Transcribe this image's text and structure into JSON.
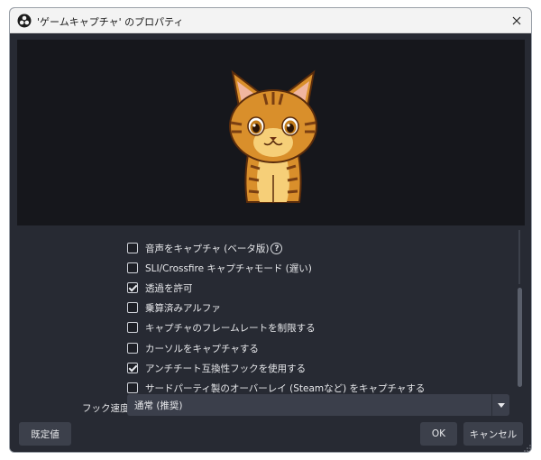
{
  "window": {
    "title": "'ゲームキャプチャ' のプロパティ",
    "close_label": "✕"
  },
  "preview": {
    "content": "cat-illustration"
  },
  "options": [
    {
      "label": "音声をキャプチャ (ベータ版)",
      "checked": false,
      "has_help": true
    },
    {
      "label": "SLI/Crossfire キャプチャモード (遅い)",
      "checked": false,
      "has_help": false
    },
    {
      "label": "透過を許可",
      "checked": true,
      "has_help": false
    },
    {
      "label": "乗算済みアルファ",
      "checked": false,
      "has_help": false
    },
    {
      "label": "キャプチャのフレームレートを制限する",
      "checked": false,
      "has_help": false
    },
    {
      "label": "カーソルをキャプチャする",
      "checked": false,
      "has_help": false
    },
    {
      "label": "アンチチート互換性フックを使用する",
      "checked": true,
      "has_help": false
    },
    {
      "label": "サードパーティ製のオーバーレイ (Steamなど) をキャプチャする",
      "checked": false,
      "has_help": false
    }
  ],
  "hook_speed": {
    "label": "フック速度",
    "value": "通常 (推奨)"
  },
  "footer": {
    "defaults_label": "既定値",
    "ok_label": "OK",
    "cancel_label": "キャンセル"
  },
  "colors": {
    "dialog_bg": "#272a33",
    "preview_bg": "#16171c",
    "button_bg": "#3c404b",
    "cat_orange": "#d98f2b",
    "cat_stripe": "#7a3f12"
  }
}
